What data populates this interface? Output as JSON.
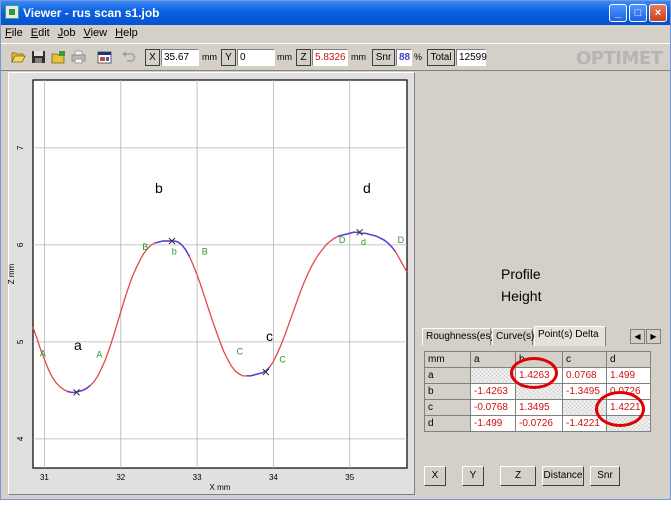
{
  "window": {
    "title": "Viewer - rus scan s1.job",
    "buttons": {
      "minimize": "_",
      "maximize": "□",
      "close": "×"
    }
  },
  "menu": [
    "File",
    "Edit",
    "Job",
    "View",
    "Help"
  ],
  "toolbar": {
    "icons": [
      "open-folder-icon",
      "save-icon",
      "open-job-icon",
      "print-icon",
      "properties-icon",
      "undo-icon"
    ],
    "x_label": "X",
    "x_value": "35.67",
    "x_unit": "mm",
    "y_label": "Y",
    "y_value": "0",
    "y_unit": "mm",
    "z_label": "Z",
    "z_value": "5.8326",
    "z_unit": "mm",
    "snr_label": "Snr",
    "snr_value": "88",
    "snr_unit": "%",
    "total_label": "Total",
    "total_value": "12599",
    "z_value_color": "#d01010",
    "snr_value_color": "#4040c0"
  },
  "logo": "OPTIMET",
  "chart_data": {
    "type": "line",
    "xlabel": "X mm",
    "ylabel": "Z mm",
    "xlim": [
      30.85,
      35.75
    ],
    "ylim": [
      3.7,
      7.7
    ],
    "xticks": [
      31,
      32,
      33,
      34,
      35
    ],
    "yticks": [
      4,
      5,
      6,
      7
    ],
    "grid": true,
    "line_color": "#e34848",
    "highlight_color": "#5a40d8",
    "series": [
      {
        "x": [
          30.85,
          30.9,
          30.95,
          31.0,
          31.05,
          31.1,
          31.15,
          31.2,
          31.25,
          31.3,
          31.35,
          31.4,
          31.45,
          31.5,
          31.55,
          31.6,
          31.65,
          31.7,
          31.75,
          31.8,
          31.85,
          31.9,
          31.95,
          32.0,
          32.05,
          32.1,
          32.15,
          32.2,
          32.25,
          32.3,
          32.35,
          32.4,
          32.45,
          32.5,
          32.55,
          32.6,
          32.65,
          32.7,
          32.75,
          32.8,
          32.85,
          32.9,
          32.95,
          33.0,
          33.05,
          33.1,
          33.15,
          33.2,
          33.25,
          33.3,
          33.35,
          33.4,
          33.45,
          33.5,
          33.55,
          33.6,
          33.65,
          33.7,
          33.75,
          33.8,
          33.85,
          33.9,
          33.95,
          34.0,
          34.05,
          34.1,
          34.15,
          34.2,
          34.25,
          34.3,
          34.35,
          34.4,
          34.45,
          34.5,
          34.55,
          34.6,
          34.65,
          34.7,
          34.75,
          34.8,
          34.85,
          34.9,
          34.95,
          35.0,
          35.05,
          35.1,
          35.15,
          35.2,
          35.25,
          35.3,
          35.35,
          35.4,
          35.45,
          35.5,
          35.55,
          35.6,
          35.65,
          35.7,
          35.75
        ],
        "y": [
          5.15,
          5.04,
          4.92,
          4.82,
          4.72,
          4.64,
          4.58,
          4.54,
          4.51,
          4.49,
          4.48,
          4.48,
          4.49,
          4.5,
          4.52,
          4.55,
          4.59,
          4.65,
          4.73,
          4.82,
          4.93,
          5.05,
          5.18,
          5.31,
          5.44,
          5.56,
          5.67,
          5.76,
          5.84,
          5.91,
          5.96,
          6.0,
          6.02,
          6.03,
          6.04,
          6.04,
          6.04,
          6.04,
          6.03,
          6.0,
          5.95,
          5.88,
          5.79,
          5.69,
          5.58,
          5.46,
          5.34,
          5.22,
          5.11,
          5.0,
          4.9,
          4.82,
          4.75,
          4.7,
          4.67,
          4.65,
          4.65,
          4.65,
          4.66,
          4.67,
          4.68,
          4.7,
          4.74,
          4.8,
          4.88,
          4.97,
          5.07,
          5.18,
          5.29,
          5.4,
          5.51,
          5.61,
          5.7,
          5.78,
          5.85,
          5.91,
          5.96,
          6.01,
          6.04,
          6.07,
          6.09,
          6.1,
          6.11,
          6.12,
          6.13,
          6.13,
          6.12,
          6.12,
          6.11,
          6.1,
          6.09,
          6.07,
          6.05,
          6.02,
          5.98,
          5.93,
          5.86,
          5.79,
          5.72
        ]
      }
    ],
    "highlights": [
      [
        31.28,
        31.62
      ],
      [
        32.42,
        32.92
      ],
      [
        33.62,
        33.97
      ],
      [
        34.85,
        35.6
      ]
    ],
    "marker_labels": [
      {
        "text": "A",
        "x": 30.98,
        "y": 4.85
      },
      {
        "text": "A",
        "x": 31.72,
        "y": 4.84
      },
      {
        "text": "B",
        "x": 32.32,
        "y": 5.95
      },
      {
        "text": "b",
        "x": 32.7,
        "y": 5.9
      },
      {
        "text": "B",
        "x": 33.1,
        "y": 5.9
      },
      {
        "text": "C",
        "x": 33.56,
        "y": 4.87
      },
      {
        "text": "C",
        "x": 34.12,
        "y": 4.79
      },
      {
        "text": "D",
        "x": 34.9,
        "y": 6.02
      },
      {
        "text": "d",
        "x": 35.18,
        "y": 6.0
      },
      {
        "text": "D",
        "x": 35.67,
        "y": 6.02
      }
    ],
    "crosses": [
      {
        "x": 31.42,
        "y": 4.48
      },
      {
        "x": 32.67,
        "y": 6.04
      },
      {
        "x": 33.9,
        "y": 4.69
      },
      {
        "x": 35.13,
        "y": 6.13
      }
    ],
    "marker_color": "#2a9a2a"
  },
  "annotations": {
    "a": "a",
    "b": "b",
    "c": "c",
    "d": "d",
    "profile_line1": "Profile",
    "profile_line2": "Height"
  },
  "tabs": [
    "Roughness(es)",
    "Curve(s)",
    "Point(s) Delta"
  ],
  "tab_scroll": {
    "left": "◀",
    "right": "▶"
  },
  "delta_table": {
    "headers": [
      "mm",
      "a",
      "b",
      "c",
      "d"
    ],
    "rows": [
      {
        "label": "a",
        "cells": [
          "",
          "1.4263",
          "0.0768",
          "1.499"
        ]
      },
      {
        "label": "b",
        "cells": [
          "-1.4263",
          "",
          "-1.3495",
          "0.0726"
        ]
      },
      {
        "label": "c",
        "cells": [
          "-0.0768",
          "1.3495",
          "",
          "1.4221"
        ]
      },
      {
        "label": "d",
        "cells": [
          "-1.499",
          "-0.0726",
          "-1.4221",
          ""
        ]
      }
    ]
  },
  "bottom_buttons": [
    "X",
    "Y",
    "Z",
    "Distance",
    "Snr"
  ]
}
